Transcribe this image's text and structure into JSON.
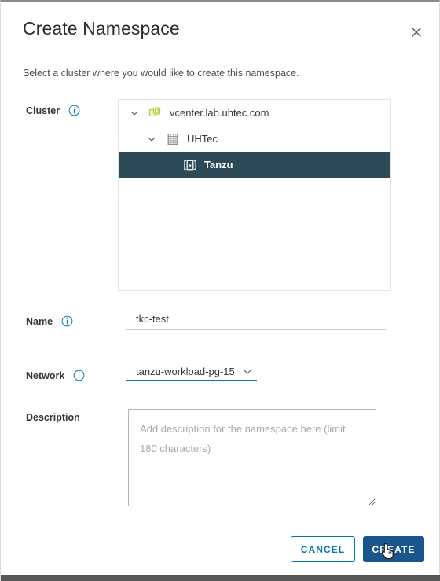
{
  "window": {
    "title": "Create Namespace",
    "close_icon": "close-icon"
  },
  "body": {
    "intro": "Select a cluster where you would like to create this namespace."
  },
  "fields": {
    "cluster": {
      "label": "Cluster",
      "info_icon": "info-icon"
    },
    "name": {
      "label": "Name",
      "info_icon": "info-icon",
      "value": "tkc-test",
      "placeholder": ""
    },
    "network": {
      "label": "Network",
      "info_icon": "info-icon",
      "value": "tanzu-workload-pg-15",
      "caret_icon": "chevron-down-icon"
    },
    "description": {
      "label": "Description",
      "value": "",
      "placeholder": "Add description for the namespace here (limit 180 characters)"
    }
  },
  "tree": {
    "nodes": [
      {
        "label": "vcenter.lab.uhtec.com",
        "icon": "vcenter-icon",
        "level": 0,
        "expanded": true,
        "selected": false,
        "caret_icon": "chevron-down-icon"
      },
      {
        "label": "UHTec",
        "icon": "datacenter-icon",
        "level": 1,
        "expanded": true,
        "selected": false,
        "caret_icon": "chevron-down-icon"
      },
      {
        "label": "Tanzu",
        "icon": "cluster-icon",
        "level": 2,
        "expanded": false,
        "selected": true,
        "caret_icon": ""
      }
    ]
  },
  "footer": {
    "cancel_label": "CANCEL",
    "create_label": "CREATE"
  },
  "colors": {
    "accent": "#0079b8",
    "primary_button": "#19568e",
    "selected_row": "#2c4a57",
    "vcenter_icon": "#b7cc45",
    "text": "#363636",
    "bottom_bar": "#565656"
  },
  "cursor": {
    "icon": "pointer-hand-cursor"
  }
}
